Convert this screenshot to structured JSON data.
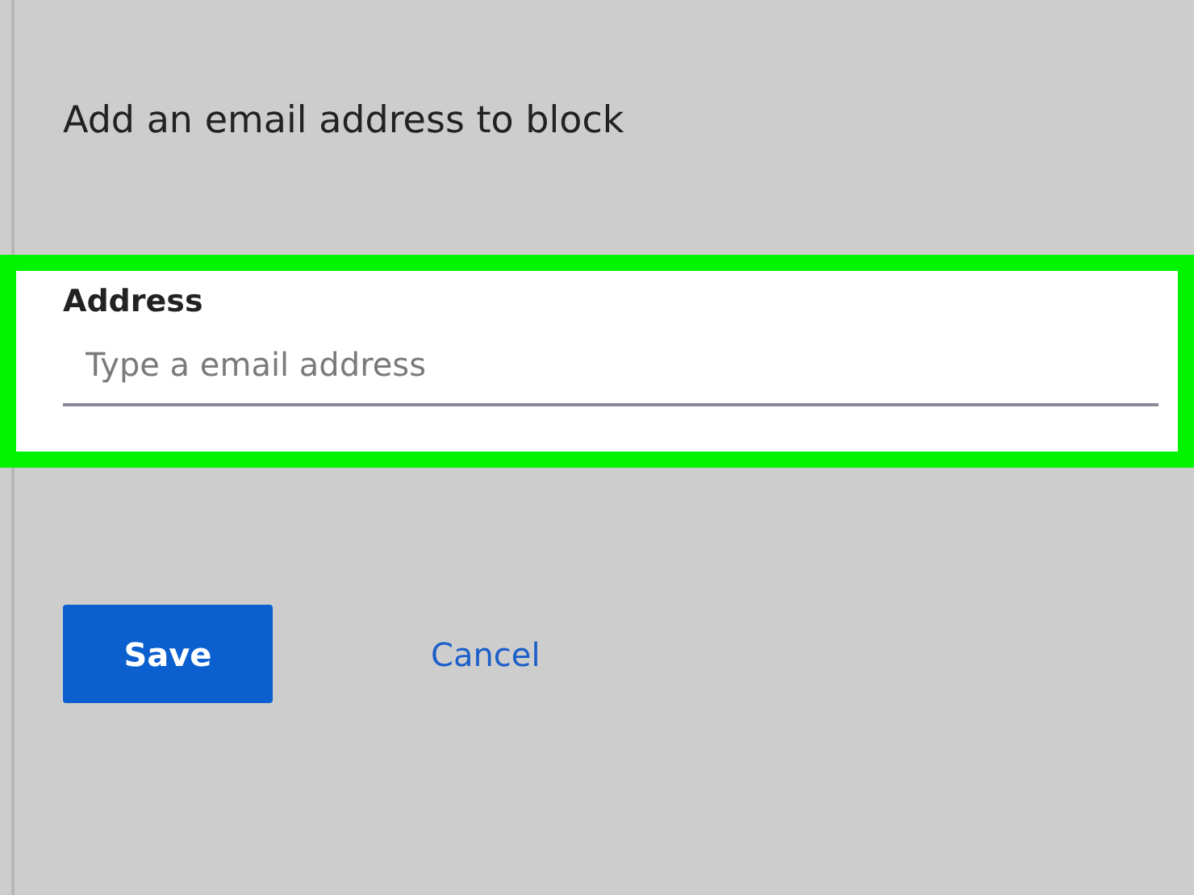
{
  "heading": "Add an email address to block",
  "address_field": {
    "label": "Address",
    "placeholder": "Type a email address"
  },
  "buttons": [
    {
      "kind": "primary",
      "label": "Save"
    },
    {
      "kind": "link",
      "label": "Cancel"
    }
  ]
}
